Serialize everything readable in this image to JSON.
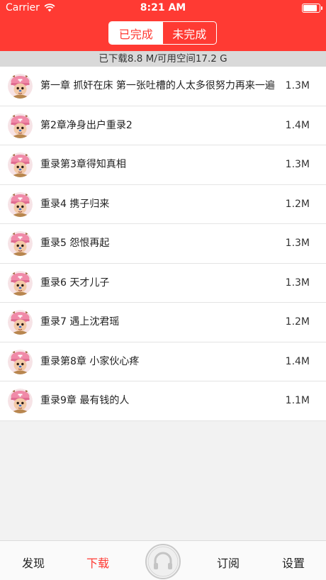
{
  "status_bar": {
    "carrier": "Carrier",
    "time": "8:21 AM"
  },
  "segment": {
    "done_label": "已完成",
    "pending_label": "未完成"
  },
  "storage": {
    "text": "已下载8.8 M/可用空间17.2 G"
  },
  "downloads": [
    {
      "title": "第一章 抓奸在床 第一张吐槽的人太多很努力再来一遍",
      "size": "1.3M"
    },
    {
      "title": "第2章净身出户重录2",
      "size": "1.4M"
    },
    {
      "title": "重录第3章得知真相",
      "size": "1.3M"
    },
    {
      "title": "重录4 携子归来",
      "size": "1.2M"
    },
    {
      "title": "重录5 怨恨再起",
      "size": "1.3M"
    },
    {
      "title": "重录6 天才儿子",
      "size": "1.3M"
    },
    {
      "title": "重录7 遇上沈君瑶",
      "size": "1.2M"
    },
    {
      "title": "重录第8章 小家伙心疼",
      "size": "1.4M"
    },
    {
      "title": "重录9章 最有钱的人",
      "size": "1.1M"
    }
  ],
  "tabbar": {
    "discover": "发现",
    "download": "下载",
    "subscribe": "订阅",
    "settings": "设置"
  },
  "icons": {
    "wifi": "wifi-icon",
    "battery": "battery-icon",
    "avatar": "chopper-avatar-icon",
    "player": "headphones-icon"
  },
  "colors": {
    "brand": "#ff3a33",
    "storage_bar": "#d9d9d9",
    "background": "#f2f2f2"
  }
}
